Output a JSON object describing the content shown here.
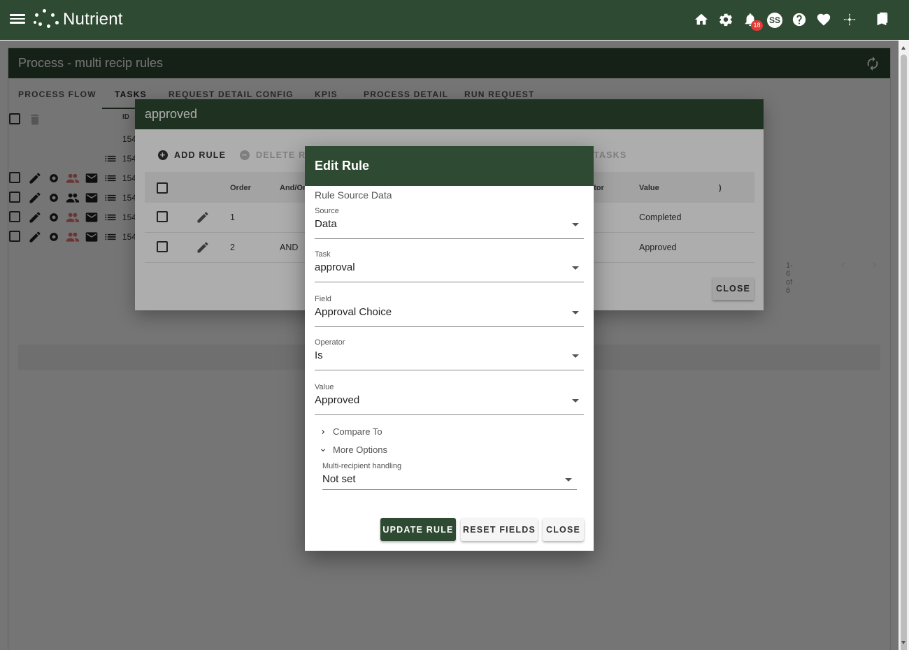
{
  "app": {
    "brand": "Nutrient",
    "notifications_count": "18",
    "user_initials": "SS",
    "accent_color": "#2f4a32"
  },
  "icons": {
    "menu": "hamburger-menu-icon",
    "home": "home-icon",
    "settings": "gear-icon",
    "notifications": "bell-icon",
    "help": "help-icon",
    "favorites": "heart-icon",
    "network": "network-icon",
    "bookmark": "bookmark-icon"
  },
  "panel": {
    "title": "Process - multi recip rules",
    "tabs": [
      "PROCESS FLOW",
      "TASKS",
      "REQUEST DETAIL CONFIG",
      "KPIS",
      "PROCESS DETAIL",
      "RUN REQUEST"
    ],
    "id_header": "ID",
    "row_ids": [
      "154",
      "154",
      "154",
      "154",
      "154",
      "154"
    ]
  },
  "rules_dialog": {
    "title": "approved",
    "add_rule": "ADD RULE",
    "delete_rule": "DELETE RU",
    "tasks_action": "TASKS",
    "columns": {
      "order": "Order",
      "and_or": "And/Or",
      "operator": "ator",
      "value": "Value",
      "paren": ")"
    },
    "rows": [
      {
        "order": "1",
        "and_or": "",
        "value": "Completed"
      },
      {
        "order": "2",
        "and_or": "AND",
        "value": "Approved"
      }
    ],
    "pagination": "1-6 of 6",
    "close_label": "CLOSE"
  },
  "edit_rule": {
    "title": "Edit Rule",
    "section_title": "Rule Source Data",
    "fields": {
      "source": {
        "label": "Source",
        "value": "Data"
      },
      "task": {
        "label": "Task",
        "value": "approval"
      },
      "field": {
        "label": "Field",
        "value": "Approval Choice"
      },
      "operator": {
        "label": "Operator",
        "value": "Is"
      },
      "value": {
        "label": "Value",
        "value": "Approved"
      }
    },
    "compare_to": "Compare To",
    "more_options": "More Options",
    "multi_recipient": {
      "label": "Multi-recipient handling",
      "value": "Not set"
    },
    "buttons": {
      "update": "UPDATE RULE",
      "reset": "RESET FIELDS",
      "close": "CLOSE"
    }
  }
}
